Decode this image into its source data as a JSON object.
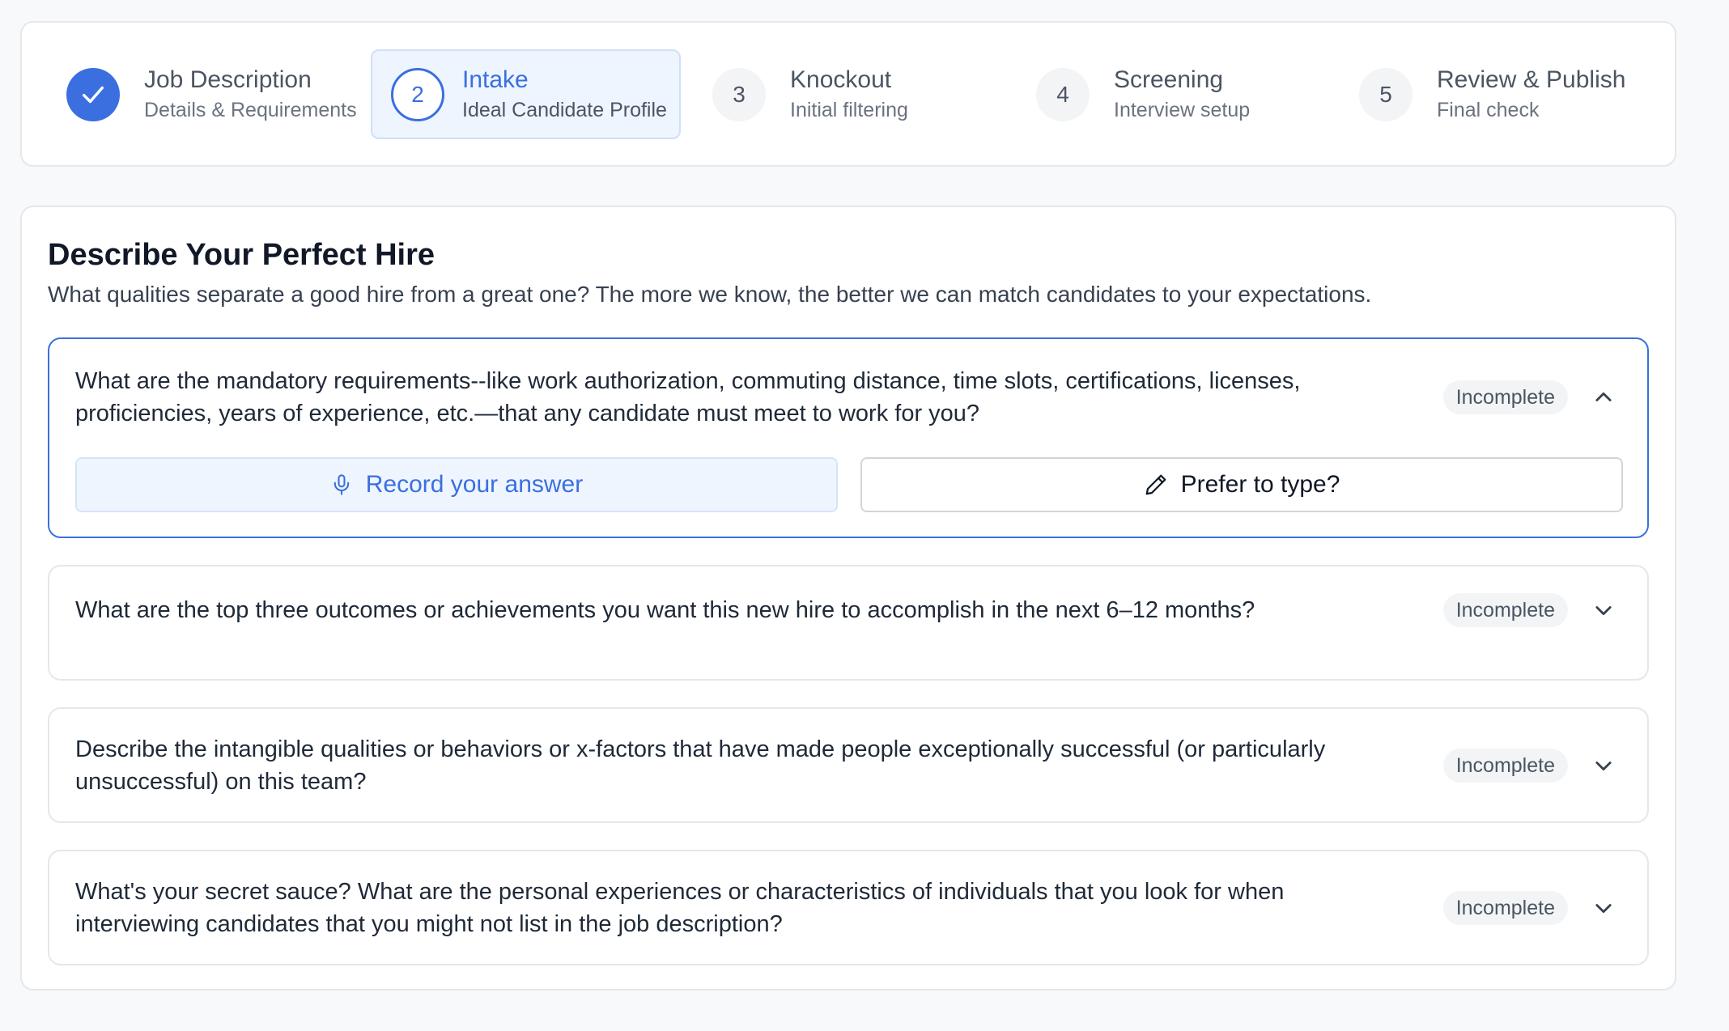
{
  "stepper": {
    "steps": [
      {
        "number": "",
        "title": "Job Description",
        "subtitle": "Details & Requirements",
        "state": "done",
        "icon": "check-icon"
      },
      {
        "number": "2",
        "title": "Intake",
        "subtitle": "Ideal Candidate Profile",
        "state": "current"
      },
      {
        "number": "3",
        "title": "Knockout",
        "subtitle": "Initial filtering",
        "state": "upcoming"
      },
      {
        "number": "4",
        "title": "Screening",
        "subtitle": "Interview setup",
        "state": "upcoming"
      },
      {
        "number": "5",
        "title": "Review & Publish",
        "subtitle": "Final check",
        "state": "upcoming"
      }
    ]
  },
  "main": {
    "title": "Describe Your Perfect Hire",
    "subtitle": "What qualities separate a good hire from a great one? The more we know, the better we can match candidates to your expectations.",
    "questions": [
      {
        "text": "What are the mandatory requirements--like work authorization, commuting distance, time slots, certifications, licenses, proficiencies, years of experience, etc.—that any candidate must meet to work for you?",
        "status": "Incomplete",
        "expanded": true,
        "record_label": "Record your answer",
        "type_label": "Prefer to type?"
      },
      {
        "text": "What are the top three outcomes or achievements you want this new hire to accomplish in the next 6–12 months?",
        "status": "Incomplete",
        "expanded": false
      },
      {
        "text": "Describe the intangible qualities or behaviors or x-factors that have made people exceptionally successful (or particularly unsuccessful) on this team?",
        "status": "Incomplete",
        "expanded": false
      },
      {
        "text": "What's your secret sauce? What are the personal experiences or characteristics of individuals that you look for when interviewing candidates that you might not list in the job description?",
        "status": "Incomplete",
        "expanded": false
      }
    ]
  },
  "colors": {
    "accent": "#3b6fe0",
    "accent_light": "#eef5fe",
    "badge_bg": "#f3f4f6",
    "border": "#e5e7eb"
  }
}
